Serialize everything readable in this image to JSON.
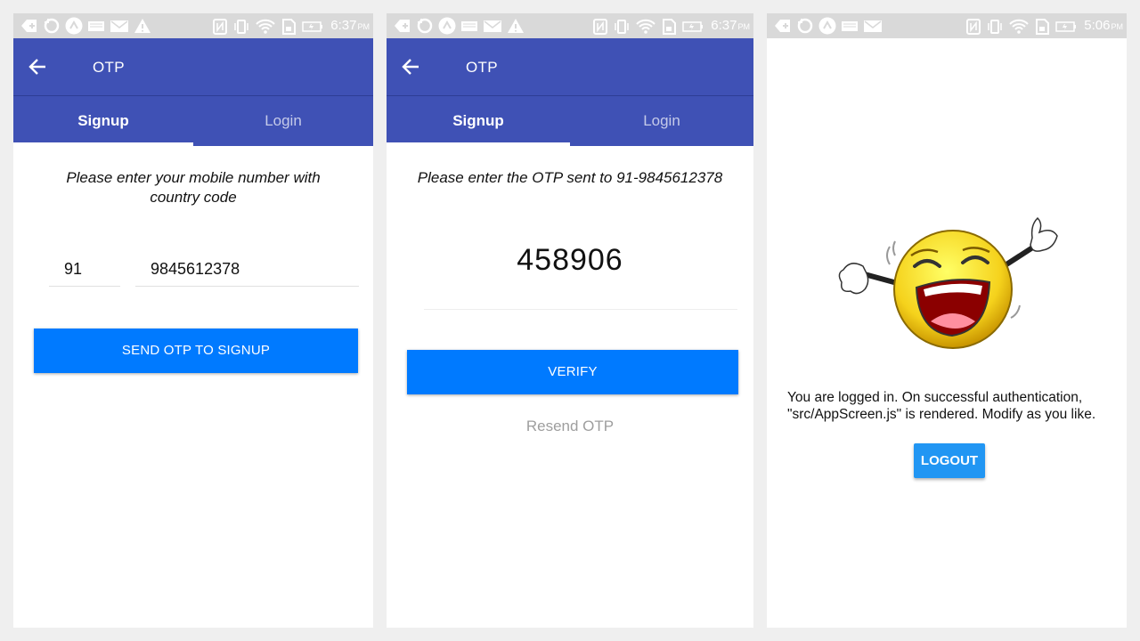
{
  "colors": {
    "app_bar": "#3f51b5",
    "primary_button": "#007aff",
    "logout_button": "#2196f3",
    "status_bar": "#d9d9d9"
  },
  "screens": [
    {
      "status": {
        "time": "6:37",
        "ampm": "PM",
        "icons": [
          "add-notification-icon",
          "sync-icon",
          "app-icon",
          "keyboard-icon",
          "mail-icon",
          "warning-icon",
          "nfc-icon",
          "vibrate-icon",
          "wifi-icon",
          "sim-icon",
          "battery-icon"
        ]
      },
      "title": "OTP",
      "tabs": [
        "Signup",
        "Login"
      ],
      "instruction_line1": "Please enter your mobile number with",
      "instruction_line2": "country code",
      "country_code": "91",
      "phone_number": "9845612378",
      "button": "SEND OTP TO SIGNUP"
    },
    {
      "status": {
        "time": "6:37",
        "ampm": "PM"
      },
      "title": "OTP",
      "tabs": [
        "Signup",
        "Login"
      ],
      "instruction": "Please enter the OTP sent to 91-9845612378",
      "otp": "458906",
      "button": "VERIFY",
      "resend": "Resend OTP"
    },
    {
      "status": {
        "time": "5:06",
        "ampm": "PM"
      },
      "image": "laughing-emoji",
      "message_line1": "You are logged in. On successful authentication,",
      "message_line2": "\"src/AppScreen.js\" is rendered. Modify as you like.",
      "button": "LOGOUT"
    }
  ]
}
